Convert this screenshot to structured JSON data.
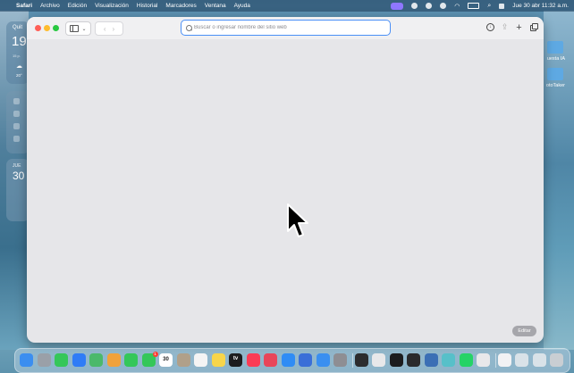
{
  "menubar": {
    "app": "Safari",
    "items": [
      "Archivo",
      "Edición",
      "Visualización",
      "Historial",
      "Marcadores",
      "Ventana",
      "Ayuda"
    ],
    "clock": "Jue 30 abr  11:32 a.m."
  },
  "widgets": {
    "weather": {
      "city": "Quit",
      "temp": "19",
      "detail": "15 p.",
      "hour_temp": "20°"
    },
    "calendar": {
      "day": "JUE",
      "date": "30"
    }
  },
  "desktop": {
    "items": [
      {
        "label": "uesta IA",
        "color": "#5ea9e3"
      },
      {
        "label": "otoTaker",
        "color": "#5ea9e3"
      }
    ]
  },
  "safari": {
    "address_placeholder": "Buscar o ingresar nombre del sitio web",
    "edit_label": "Editar"
  },
  "dock": {
    "apps": [
      {
        "name": "Finder",
        "color": "#3b8ef0",
        "glyph": ""
      },
      {
        "name": "Launchpad",
        "color": "#9aa0a8",
        "glyph": ""
      },
      {
        "name": "Messages",
        "color": "#35c759",
        "glyph": ""
      },
      {
        "name": "Mail",
        "color": "#2f7cf6",
        "glyph": ""
      },
      {
        "name": "Maps",
        "color": "#4bb96b",
        "glyph": ""
      },
      {
        "name": "Photos",
        "color": "#f0a23b",
        "glyph": ""
      },
      {
        "name": "FaceTime",
        "color": "#34c759",
        "glyph": ""
      },
      {
        "name": "Phone",
        "color": "#34c759",
        "glyph": ""
      },
      {
        "name": "Calendar",
        "color": "#ffffff",
        "glyph": "30"
      },
      {
        "name": "Contacts",
        "color": "#b0a08a",
        "glyph": ""
      },
      {
        "name": "Reminders",
        "color": "#f4f4f4",
        "glyph": ""
      },
      {
        "name": "Notes",
        "color": "#f8d54a",
        "glyph": ""
      },
      {
        "name": "TV",
        "color": "#1c1c1e",
        "glyph": "tv"
      },
      {
        "name": "Music",
        "color": "#fa3c55",
        "glyph": ""
      },
      {
        "name": "Rocket",
        "color": "#e8465a",
        "glyph": ""
      },
      {
        "name": "App Store",
        "color": "#2f8cf5",
        "glyph": ""
      },
      {
        "name": "Pages",
        "color": "#3a6fd8",
        "glyph": ""
      },
      {
        "name": "Safari",
        "color": "#3a8ff0",
        "glyph": ""
      },
      {
        "name": "System Settings",
        "color": "#8e8e93",
        "glyph": ""
      },
      {
        "name": "Activity Monitor",
        "color": "#2c2c2e",
        "glyph": ""
      },
      {
        "name": "Grid",
        "color": "#e8e8ea",
        "glyph": ""
      },
      {
        "name": "Cursor",
        "color": "#1c1c1e",
        "glyph": ""
      },
      {
        "name": "Terminal",
        "color": "#2a2a2c",
        "glyph": ""
      },
      {
        "name": "Ollama",
        "color": "#3b6fb5",
        "glyph": ""
      },
      {
        "name": "Copilot",
        "color": "#57c0c9",
        "glyph": ""
      },
      {
        "name": "WhatsApp",
        "color": "#25d366",
        "glyph": ""
      },
      {
        "name": "Bluetooth",
        "color": "#e8e8ea",
        "glyph": ""
      },
      {
        "name": "Document",
        "color": "#f2f2f4",
        "glyph": ""
      },
      {
        "name": "Window",
        "color": "#d9e2e8",
        "glyph": ""
      },
      {
        "name": "Window 2",
        "color": "#d9e2e8",
        "glyph": ""
      },
      {
        "name": "Trash",
        "color": "#c9ced3",
        "glyph": ""
      }
    ],
    "calendar_badge": "1"
  }
}
